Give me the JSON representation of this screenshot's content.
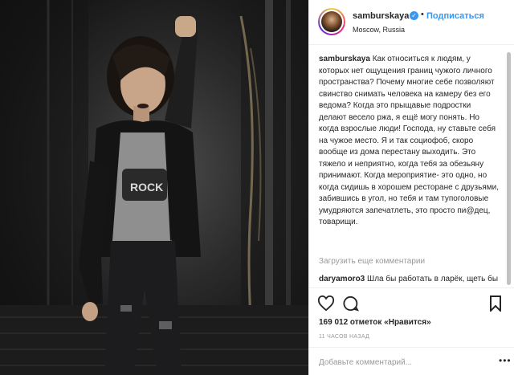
{
  "post": {
    "username": "samburskaya",
    "verified_glyph": "✓",
    "separator": "•",
    "follow_label": "Подписаться",
    "location": "Moscow, Russia",
    "caption_author": "samburskaya",
    "caption_text": "Как относиться к людям, у которых нет ощущения границ чужого личного пространства? Почему многие себе позволяют свинство снимать человека на камеру без его ведома? Когда это прыщавые подростки делают весело ржа, я ещё могу понять. Но когда взрослые люди! Господа, ну ставьте себя на чужое место. Я и так социофоб, скоро вообще из дома перестану выходить. Это тяжело и неприятно, когда тебя за обезьяну принимают. Когда мероприятие- это одно, но когда сидишь в хорошем ресторане с друзьями, забившись в угол, но тебя и там тупоголовые умудряются запечатлеть, это просто пи@дец, товарищи.",
    "load_more_label": "Загрузить еще комментарии",
    "comment2_author": "daryamoro3",
    "comment2_text": "Шла бы работать в ларёк, щеть бы не было",
    "likes_label": "169 012 отметок «Нравится»",
    "time_label": "11 ЧАСОВ НАЗАД",
    "comment_placeholder": "Добавьте комментарий...",
    "more_glyph": "•••"
  },
  "icons": {
    "like": "heart-icon",
    "comment": "comment-icon",
    "save": "bookmark-icon",
    "verified": "verified-badge-icon",
    "more": "more-options-icon"
  },
  "colors": {
    "accent": "#3897f0",
    "text": "#262626",
    "muted": "#999999",
    "border": "#efefef"
  }
}
